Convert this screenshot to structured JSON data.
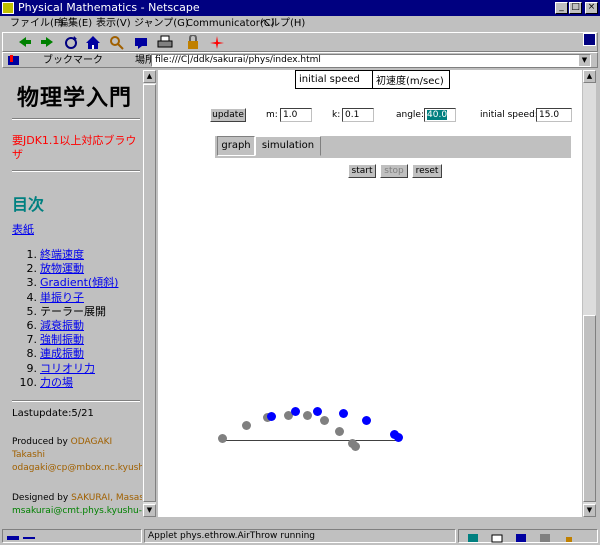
{
  "window": {
    "title": "Physical Mathematics - Netscape",
    "buttons": {
      "minimize": "_",
      "maximize": "□",
      "close": "×"
    }
  },
  "menubar": [
    "ファイル(F)",
    "編集(E)",
    "表示(V)",
    "ジャンプ(G)",
    "Communicator(C)",
    "ヘルプ(H)"
  ],
  "toolbar": {
    "icons": [
      "back-icon",
      "forward-icon",
      "reload-icon",
      "home-icon",
      "search-icon",
      "guide-icon",
      "print-icon",
      "security-icon",
      "stop-icon"
    ]
  },
  "locationbar": {
    "bookmarks_label": "ブックマーク",
    "location_label": "場所:",
    "url": "file:///C|/ddk/sakurai/phys/index.html"
  },
  "left_frame": {
    "title": "物理学入門",
    "jdk_note": "要JDK1.1以上対応ブラウザ",
    "toc_heading": "目次",
    "cover_link": "表紙",
    "toc": [
      {
        "num": "1.",
        "label": "終端速度",
        "link": true
      },
      {
        "num": "2.",
        "label": "放物運動",
        "link": true
      },
      {
        "num": "3.",
        "label": "Gradient(傾斜)",
        "link": true
      },
      {
        "num": "4.",
        "label": "単振り子",
        "link": true
      },
      {
        "num": "5.",
        "label": "テーラー展開",
        "link": false
      },
      {
        "num": "6.",
        "label": "減衰振動",
        "link": true
      },
      {
        "num": "7.",
        "label": "強制振動",
        "link": true
      },
      {
        "num": "8.",
        "label": "連成振動",
        "link": true
      },
      {
        "num": "9.",
        "label": "コリオリ力",
        "link": true
      },
      {
        "num": "10.",
        "label": "力の場",
        "link": true
      }
    ],
    "last_update": "Lastupdate:5/21",
    "produced_label": "Produced by",
    "produced_name_1": "ODAGAKI",
    "produced_name_2": "Takashi",
    "produced_email": "odagaki@cp@mbox.nc.kyushu-u.ac.jp",
    "designed_label": "Designed by",
    "designed_name": "SAKURAI, Masashi",
    "designed_email": "msakurai@cmt.phys.kyushu-u.ac.jp"
  },
  "right_frame": {
    "param_table": {
      "label_en": "initial speed",
      "label_ja": "初速度(m/sec)"
    },
    "applet": {
      "update_label": "update",
      "m_label": "m:",
      "m_value": "1.0",
      "k_label": "k:",
      "k_value": "0.1",
      "angle_label": "angle:",
      "angle_value": "40.0",
      "speed_label": "initial speed:",
      "speed_value": "15.0",
      "tabs": [
        "graph",
        "simulation"
      ],
      "active_tab": "simulation",
      "start_label": "start",
      "stop_label": "stop",
      "reset_label": "reset"
    }
  },
  "statusbar": {
    "text": "Applet phys.ethrow.AirThrow running"
  },
  "colors": {
    "title_bar": "#000080",
    "heading_teal": "#008080",
    "note_red": "#ff0000",
    "link_blue": "#0000ee",
    "ball_blue": "#0000ff",
    "ball_grey": "#808080"
  }
}
